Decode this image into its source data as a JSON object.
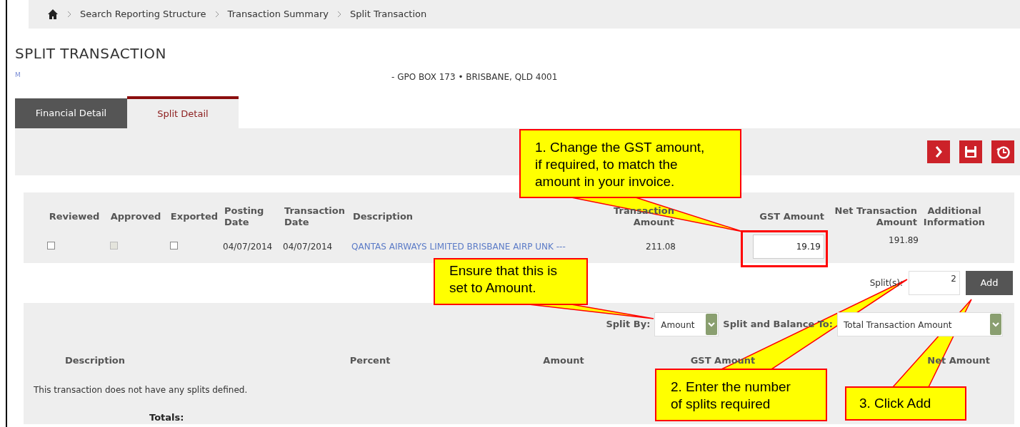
{
  "breadcrumb": [
    "Search Reporting Structure",
    "Transaction Summary",
    "Split Transaction"
  ],
  "page_title": "SPLIT TRANSACTION",
  "address": {
    "link": "M",
    "text": "- GPO BOX 173 • BRISBANE, QLD 4001"
  },
  "tabs": [
    {
      "label": "Financial Detail",
      "selected": false
    },
    {
      "label": "Split Detail",
      "selected": true
    }
  ],
  "transaction_table": {
    "columns": [
      "Reviewed",
      "Approved",
      "Exported",
      "Posting Date",
      "Transaction Date",
      "Description",
      "Transaction Amount",
      "GST Amount",
      "Net Transaction Amount",
      "Additional Information"
    ],
    "rows": [
      {
        "checkboxes": [
          {
            "checked": false,
            "disabled": false
          },
          {
            "checked": false,
            "disabled": true
          },
          {
            "checked": false,
            "disabled": false
          }
        ],
        "posting_date": "04/07/2014",
        "transaction_date": "04/07/2014",
        "description": "QANTAS AIRWAYS LIMITED BRISBANE AIRP UNK ---",
        "transaction_amount": "211.08",
        "gst_amount": "19.19",
        "net_amount": "191.89"
      }
    ]
  },
  "splits": {
    "label": "Split(s):",
    "value": "2",
    "button": "Add"
  },
  "split_by": {
    "label": "Split By:",
    "value": "Amount"
  },
  "balance_to": {
    "label": "Split and Balance To:",
    "value": "Total Transaction Amount"
  },
  "split_table": {
    "columns": [
      "Description",
      "Percent",
      "Amount",
      "GST Amount",
      "Net Amount"
    ],
    "empty_message": "This transaction does not have any splits defined.",
    "totals_label": "Totals:"
  },
  "callouts": [
    {
      "text": "1. Change the GST amount, if required, to match the amount in your invoice."
    },
    {
      "text": "Ensure that this is set to Amount."
    },
    {
      "text": "2. Enter the number of splits required"
    },
    {
      "text": "3. Click Add"
    }
  ]
}
